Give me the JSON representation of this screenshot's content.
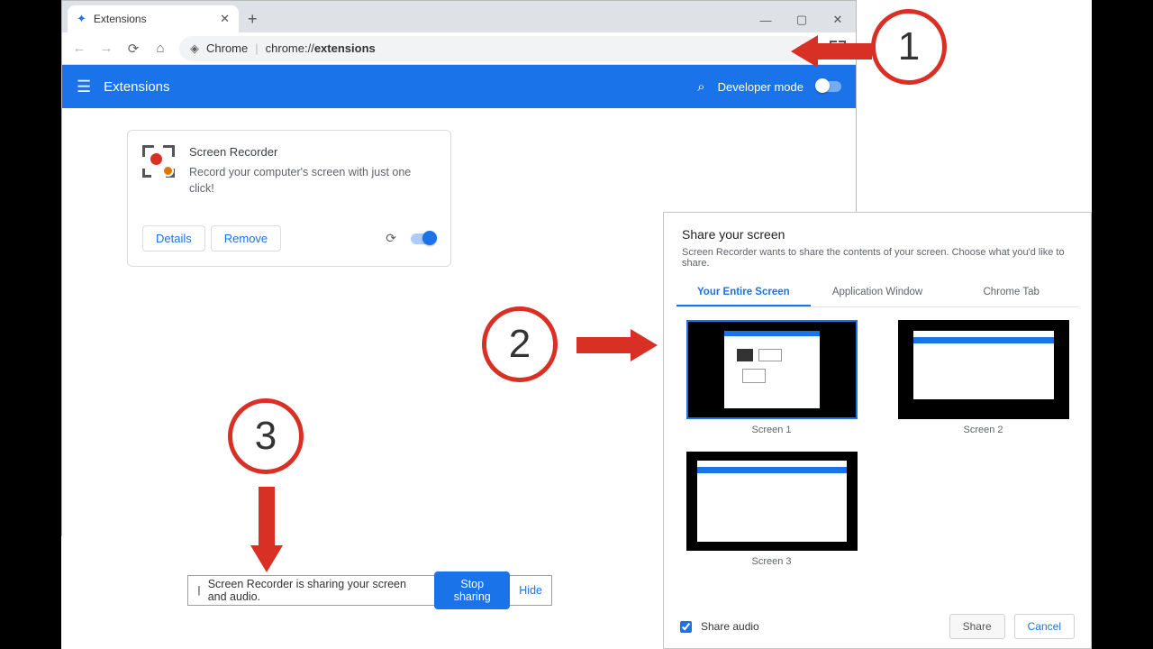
{
  "browser": {
    "tab_title": "Extensions",
    "url_prefix": "Chrome",
    "url_host": "chrome://",
    "url_path": "extensions"
  },
  "bluebar": {
    "title": "Extensions",
    "dev_mode": "Developer mode"
  },
  "card": {
    "name": "Screen Recorder",
    "desc": "Record your computer's screen with just one click!",
    "details": "Details",
    "remove": "Remove"
  },
  "sharebar": {
    "msg": "Screen Recorder is sharing your screen and audio.",
    "stop": "Stop sharing",
    "hide": "Hide"
  },
  "dialog": {
    "title": "Share your screen",
    "sub": "Screen Recorder wants to share the contents of your screen. Choose what you'd like to share.",
    "tabs": [
      "Your Entire Screen",
      "Application Window",
      "Chrome Tab"
    ],
    "thumbs": [
      "Screen 1",
      "Screen 2",
      "Screen 3"
    ],
    "share_audio": "Share audio",
    "share": "Share",
    "cancel": "Cancel"
  },
  "anno": {
    "n1": "1",
    "n2": "2",
    "n3": "3"
  }
}
